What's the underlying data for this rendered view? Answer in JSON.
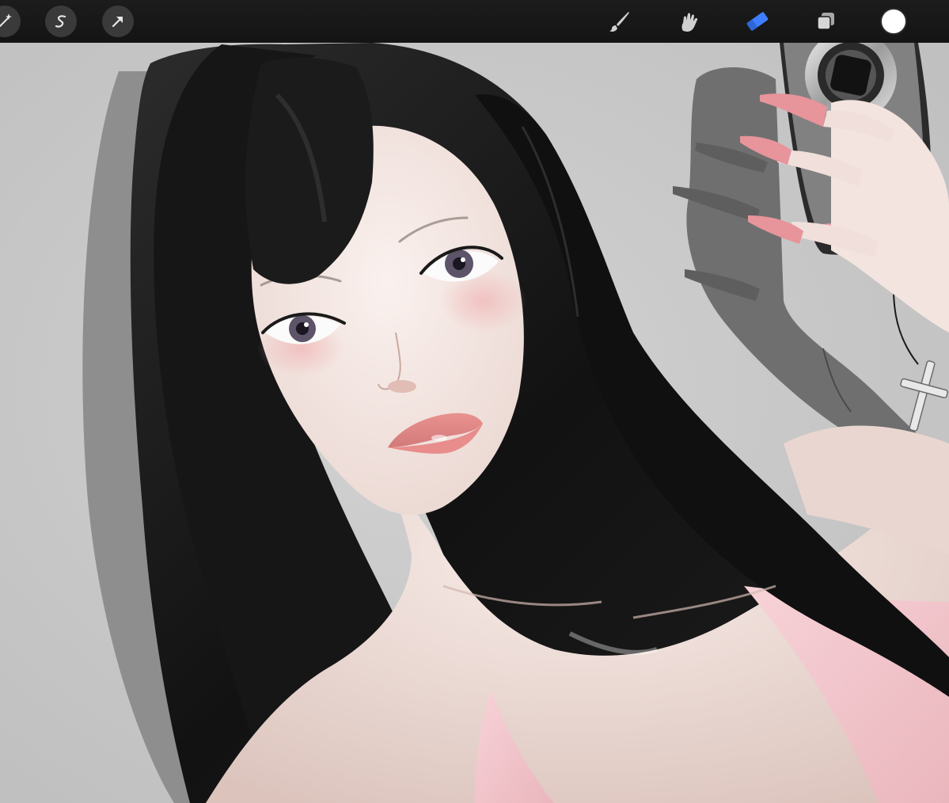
{
  "toolbar": {
    "left_tools": [
      {
        "name": "adjustments",
        "icon": "magic-wand-icon"
      },
      {
        "name": "selection",
        "icon": "selection-s-icon"
      },
      {
        "name": "transform",
        "icon": "arrow-cursor-icon"
      }
    ],
    "right_tools": [
      {
        "name": "brush",
        "icon": "brush-icon",
        "active": false
      },
      {
        "name": "smudge",
        "icon": "smudge-finger-icon",
        "active": false
      },
      {
        "name": "eraser",
        "icon": "eraser-icon",
        "active": true
      },
      {
        "name": "layers",
        "icon": "layers-icon",
        "active": false
      }
    ],
    "current_color": "#ffffff",
    "active_color": "#3d7fff"
  },
  "canvas": {
    "background_color": "#c3c3c3",
    "hair_color": "#141414",
    "skin_color": "#f2e3de",
    "top_color": "#f4c9cf",
    "nail_color": "#e7949b"
  }
}
